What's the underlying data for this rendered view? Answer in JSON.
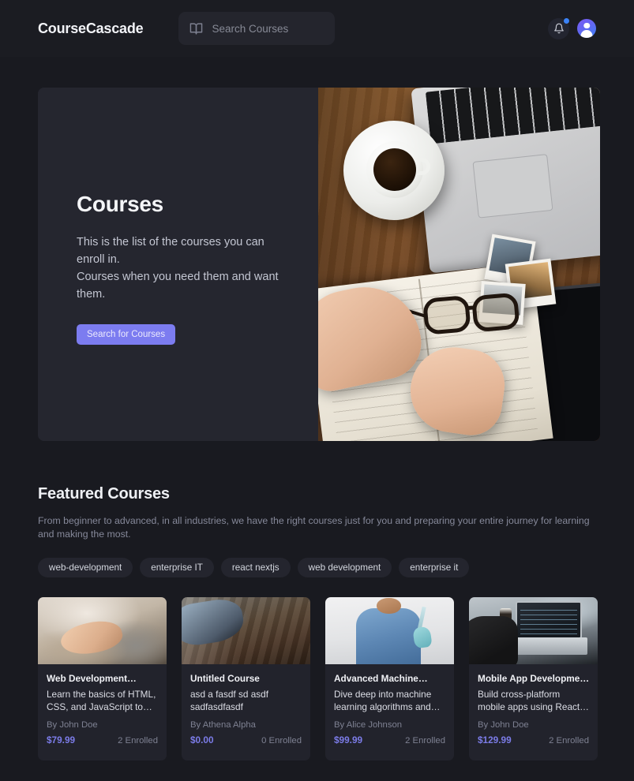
{
  "header": {
    "brand": "CourseCascade",
    "search_placeholder": "Search Courses",
    "search_value": "",
    "book_icon": "book-icon",
    "bell_icon": "bell-icon",
    "avatar_icon": "user-avatar",
    "notification_dot_color": "#3b82f6"
  },
  "hero": {
    "title": "Courses",
    "description_line1": "This is the list of the courses you can",
    "description_line2": "enroll in.",
    "description_line3": "Courses when you need them and",
    "description_line4": "want them.",
    "button_label": "Search for Courses",
    "button_color": "#7c7cf0",
    "image_alt": "desk-with-coffee-laptop-and-notebook"
  },
  "featured": {
    "title": "Featured Courses",
    "subtitle": "From beginner to advanced, in all industries, we have the right courses just for you and preparing your entire journey for learning and making the most.",
    "tags": [
      "web-development",
      "enterprise IT",
      "react nextjs",
      "web development",
      "enterprise it"
    ],
    "cards": [
      {
        "title": "Web Development…",
        "description": "Learn the basics of HTML, CSS, and JavaScript to…",
        "author": "By John Doe",
        "price": "$79.99",
        "enrolled": "2 Enrolled",
        "image_alt": "hand-petting-cat"
      },
      {
        "title": "Untitled Course",
        "description": "asd a fasdf sd asdf sadfasdfasdf",
        "author": "By Athena Alpha",
        "price": "$0.00",
        "enrolled": "0 Enrolled",
        "image_alt": "people-writing-at-wooden-table"
      },
      {
        "title": "Advanced Machine…",
        "description": "Dive deep into machine learning algorithms and…",
        "author": "By Alice Johnson",
        "price": "$99.99",
        "enrolled": "2 Enrolled",
        "image_alt": "medical-worker-holding-syringe"
      },
      {
        "title": "Mobile App Developme…",
        "description": "Build cross-platform mobile apps using React…",
        "author": "By John Doe",
        "price": "$129.99",
        "enrolled": "2 Enrolled",
        "image_alt": "person-using-laptop-and-phone"
      }
    ]
  },
  "theme": {
    "page_background": "#191a20",
    "surface": "#22232c",
    "accent": "#7c7cf0",
    "price_color": "#7c7ce8"
  }
}
